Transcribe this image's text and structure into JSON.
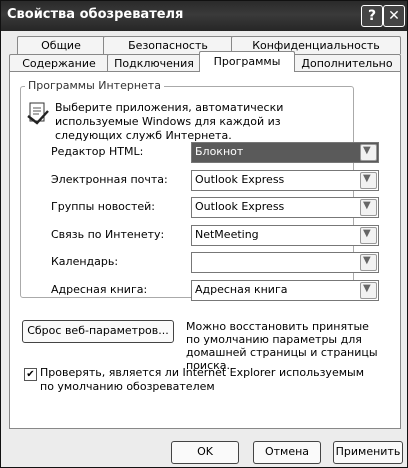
{
  "window": {
    "title": "Свойства обозревателя",
    "help": "?",
    "close": "✕"
  },
  "tabs": [
    {
      "label": "Общие",
      "active": false
    },
    {
      "label": "Безопасность",
      "active": false
    },
    {
      "label": "Конфиденциальность",
      "active": false
    },
    {
      "label": "Содержание",
      "active": false
    },
    {
      "label": "Подключения",
      "active": false
    },
    {
      "label": "Программы",
      "active": true
    },
    {
      "label": "Дополнительно",
      "active": false
    }
  ],
  "group": {
    "legend": "Программы Интернета",
    "intro": "Выберите приложения, автоматически используемые Windows для каждой из следующих служб Интернета.",
    "rows": [
      {
        "label": "Редактор HTML:",
        "value": "Блокнот",
        "selected": true
      },
      {
        "label": "Электронная почта:",
        "value": "Outlook Express",
        "selected": false
      },
      {
        "label": "Группы новостей:",
        "value": "Outlook Express",
        "selected": false
      },
      {
        "label": "Связь по Интенету:",
        "value": "NetMeeting",
        "selected": false
      },
      {
        "label": "Календарь:",
        "value": "",
        "selected": false
      },
      {
        "label": "Адресная книга:",
        "value": "Адресная книга",
        "selected": false
      }
    ]
  },
  "reset": {
    "button": "Сброс веб-параметров...",
    "note": "Можно восстановить принятые по умолчанию параметры для домашней страницы и страницы поиска."
  },
  "checkbox": {
    "checked": true,
    "label": "Проверять, является ли Internet Explorer используемым по умолчанию обозревателем"
  },
  "buttons": {
    "ok": "OK",
    "cancel": "Отмена",
    "apply": "Применить"
  }
}
